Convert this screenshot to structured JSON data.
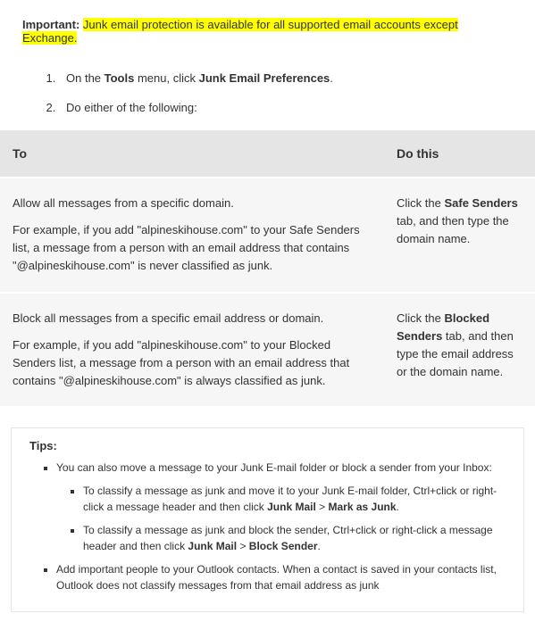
{
  "important": {
    "label": "Important:",
    "text": "Junk email protection is available for all supported email accounts except Exchange."
  },
  "steps": {
    "items": [
      {
        "prefix": "On the ",
        "b1": "Tools",
        "mid": " menu, click ",
        "b2": "Junk Email Preferences",
        "suffix": "."
      },
      {
        "prefix": "Do either of the following:",
        "b1": "",
        "mid": "",
        "b2": "",
        "suffix": ""
      }
    ]
  },
  "table": {
    "head": {
      "col1": "To",
      "col2": "Do this"
    },
    "rows": [
      {
        "left_title": "Allow all messages from a specific domain.",
        "left_body": "For example, if you add \"alpineskihouse.com\" to your Safe Senders list, a message from a person with an email address that contains \"@alpineskihouse.com\" is never classified as junk.",
        "right_prefix": "Click the ",
        "right_bold": "Safe Senders",
        "right_suffix": " tab, and then type the domain name."
      },
      {
        "left_title": "Block all messages from a specific email address or domain.",
        "left_body": "For example, if you add \"alpineskihouse.com\" to your Blocked Senders list, a message from a person with an email address that contains \"@alpineskihouse.com\" is always classified as junk.",
        "right_prefix": "Click the ",
        "right_bold": "Blocked Senders",
        "right_suffix": " tab, and then type the email address or the domain name."
      }
    ]
  },
  "tips": {
    "title": "Tips:",
    "items": [
      {
        "text": "You can also move a message to your Junk E-mail folder or block a sender from your Inbox:",
        "sub": [
          {
            "pre": "To classify a message as junk and move it to your Junk E-mail folder, Ctrl+click or right-click a message header and then click ",
            "b1": "Junk Mail",
            "mid": " > ",
            "b2": "Mark as Junk",
            "post": "."
          },
          {
            "pre": "To classify a message as junk and block the sender, Ctrl+click or right-click a message header and then click ",
            "b1": "Junk Mail",
            "mid": " > ",
            "b2": "Block Sender",
            "post": "."
          }
        ]
      },
      {
        "text": "Add important people to your Outlook contacts. When a contact is saved in your contacts list, Outlook does not classify messages from that email address as junk"
      }
    ]
  }
}
